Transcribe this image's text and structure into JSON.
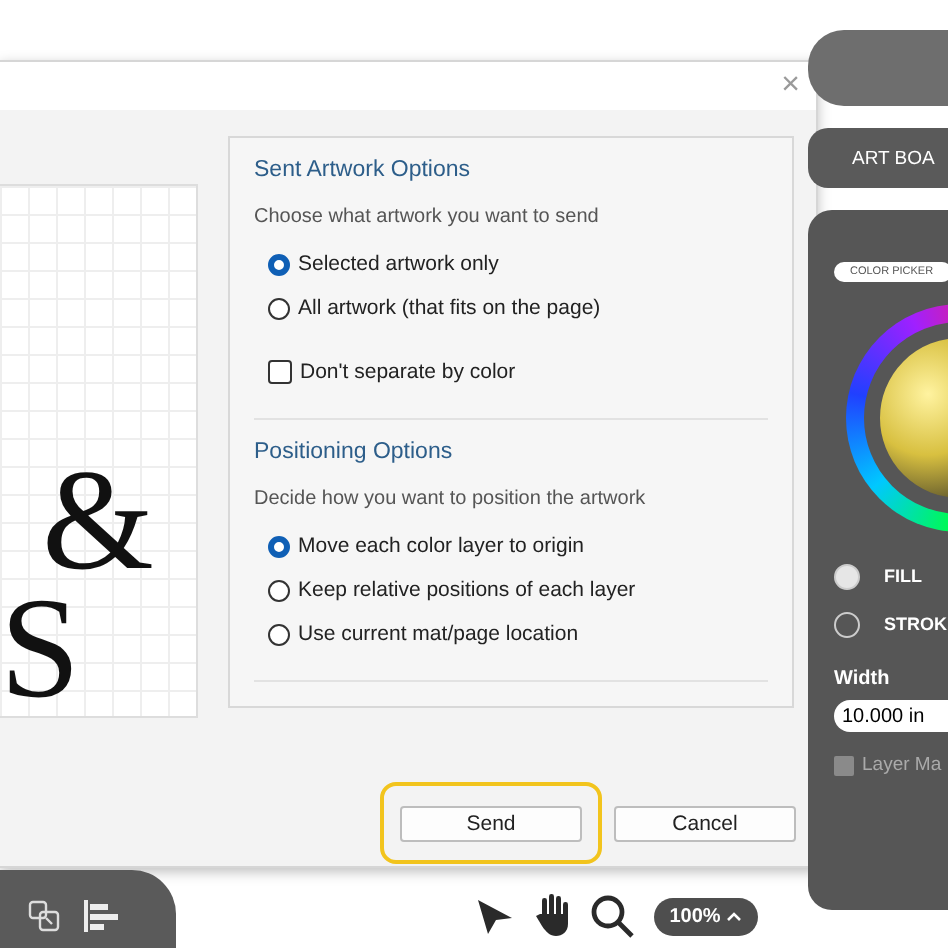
{
  "dialog": {
    "close": "×",
    "preview": {
      "glyphs": [
        "&",
        "S"
      ]
    },
    "sections": [
      {
        "title": "Sent Artwork Options",
        "description": "Choose what artwork you want to send",
        "options": [
          {
            "kind": "radio",
            "label": "Selected artwork only",
            "selected": true
          },
          {
            "kind": "radio",
            "label": "All artwork (that fits on the page)",
            "selected": false
          },
          {
            "kind": "checkbox",
            "label": "Don't separate by color",
            "checked": false
          }
        ]
      },
      {
        "title": "Positioning Options",
        "description": "Decide how you want to position the artwork",
        "options": [
          {
            "kind": "radio",
            "label": "Move each color layer to origin",
            "selected": true
          },
          {
            "kind": "radio",
            "label": "Keep relative positions of each layer",
            "selected": false
          },
          {
            "kind": "radio",
            "label": "Use current mat/page location",
            "selected": false
          }
        ]
      }
    ],
    "buttons": [
      {
        "label": "Send",
        "highlighted": true
      },
      {
        "label": "Cancel",
        "highlighted": false
      }
    ]
  },
  "right_panel": {
    "tab": "ART BOA",
    "color_picker": "COLOR PICKER",
    "swatches": [
      {
        "label": "FILL",
        "selected": true
      },
      {
        "label": "STROK",
        "selected": false
      }
    ],
    "width": {
      "label": "Width",
      "value": "10.000 in"
    },
    "layer_checkbox": {
      "label": "Layer Ma",
      "checked": false
    }
  },
  "zoom": {
    "value": "100%"
  }
}
